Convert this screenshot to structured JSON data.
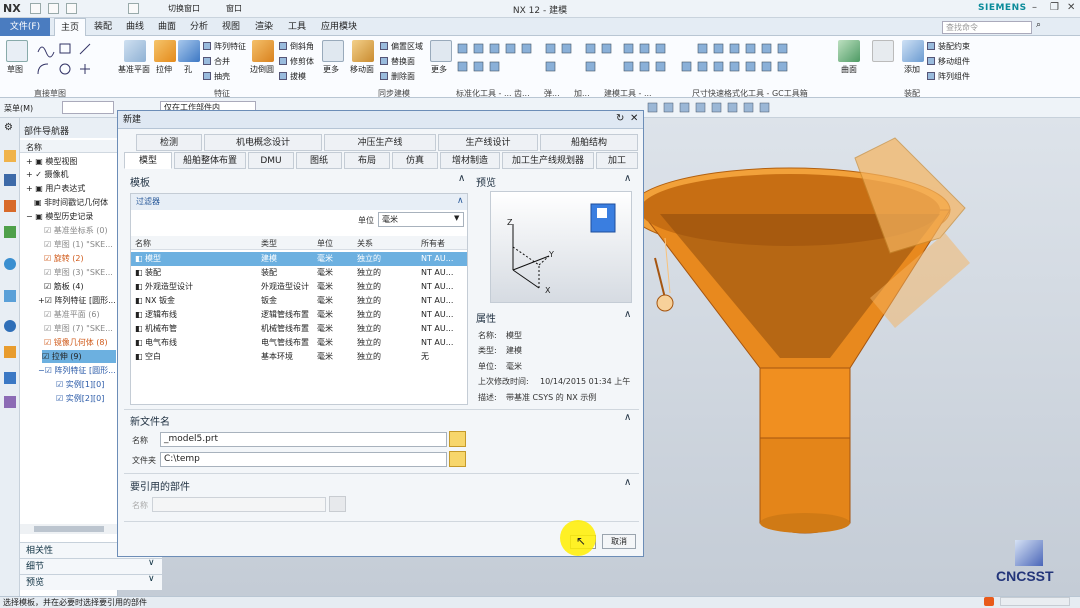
{
  "app": {
    "logo": "NX",
    "title": "NX 12 - 建模",
    "brand": "SIEMENS",
    "quick_switch_window": "切换窗口",
    "quick_window": "窗口"
  },
  "menu": {
    "file": "文件(F)",
    "tabs": [
      "主页",
      "装配",
      "曲线",
      "曲面",
      "分析",
      "视图",
      "渲染",
      "工具",
      "应用模块"
    ],
    "search_placeholder": "查找命令"
  },
  "ribbon": {
    "sketch": "草图",
    "datum_plane": "基准平面",
    "extrude": "拉伸",
    "hole": "孔",
    "pattern_feature": "阵列特征",
    "unite": "合并",
    "shell": "抽壳",
    "edge_blend": "边倒圆",
    "chamfer": "倒斜角",
    "trim_body": "修剪体",
    "draft": "拔模",
    "more1": "更多",
    "move_face": "移动面",
    "offset_region": "偏置区域",
    "replace_face": "替换面",
    "delete_face": "删除面",
    "more2": "更多",
    "surface": "曲面",
    "assembly_constraint": "装配约束",
    "add": "添加",
    "move_component": "移动组件",
    "pattern_component": "阵列组件",
    "sections": {
      "direct_sketch": "直接草图",
      "feature": "特征",
      "sync_modeling": "同步建模",
      "standard_tools": "标准化工具 - ...",
      "gear": "齿...",
      "spring": "弹...",
      "add": "加...",
      "modeling_tools": "建模工具 - ...",
      "dim_tools": "尺寸快速格式化工具 - GC工具箱",
      "assembly": "装配"
    }
  },
  "toolbar": {
    "menu": "菜单(M)",
    "filter": "仅在工作部件内"
  },
  "navigator": {
    "title": "部件导航器",
    "col_name": "名称",
    "items": [
      "模型视图",
      "摄像机",
      "用户表达式",
      "非时间戳记几何体",
      "模型历史记录",
      "基准坐标系 (0)",
      "草图 (1) \"SKE...",
      "旋转 (2)",
      "草图 (3) \"SKE...",
      "筋板 (4)",
      "阵列特征 [圆形...",
      "基准平面 (6)",
      "草图 (7) \"SKE...",
      "镜像几何体 (8)",
      "拉伸 (9)",
      "阵列特征 [圆形...",
      "实例[1][0]",
      "实例[2][0]"
    ],
    "panels": [
      "相关性",
      "细节",
      "预览"
    ]
  },
  "dialog": {
    "title": "新建",
    "tabs_row1": [
      "检测",
      "机电概念设计",
      "冲压生产线",
      "生产线设计",
      "船舶结构"
    ],
    "tabs_row2": [
      "模型",
      "船舶整体布置",
      "DMU",
      "图纸",
      "布局",
      "仿真",
      "增材制造",
      "加工生产线规划器",
      "加工"
    ],
    "template": {
      "title": "模板",
      "filter": "过滤器",
      "unit_label": "单位",
      "unit_value": "毫米",
      "columns": [
        "名称",
        "类型",
        "单位",
        "关系",
        "所有者"
      ],
      "rows": [
        [
          "模型",
          "建模",
          "毫米",
          "独立的",
          "NT AU..."
        ],
        [
          "装配",
          "装配",
          "毫米",
          "独立的",
          "NT AU..."
        ],
        [
          "外观造型设计",
          "外观造型设计",
          "毫米",
          "独立的",
          "NT AU..."
        ],
        [
          "NX 钣金",
          "钣金",
          "毫米",
          "独立的",
          "NT AU..."
        ],
        [
          "逻辑布线",
          "逻辑管线布置",
          "毫米",
          "独立的",
          "NT AU..."
        ],
        [
          "机械布管",
          "机械管线布置",
          "毫米",
          "独立的",
          "NT AU..."
        ],
        [
          "电气布线",
          "电气管线布置",
          "毫米",
          "独立的",
          "NT AU..."
        ],
        [
          "空白",
          "基本环境",
          "毫米",
          "独立的",
          "无"
        ]
      ]
    },
    "preview": {
      "title": "预览",
      "axis_x": "X",
      "axis_y": "Y",
      "axis_z": "Z"
    },
    "properties": {
      "title": "属性",
      "name_label": "名称:",
      "name_value": "模型",
      "type_label": "类型:",
      "type_value": "建模",
      "unit_label": "单位:",
      "unit_value": "毫米",
      "modified_label": "上次修改时间:",
      "modified_value": "10/14/2015 01:34 上午",
      "desc_label": "描述:",
      "desc_value": "带基准 CSYS 的 NX 示例"
    },
    "newfile": {
      "title": "新文件名",
      "name_label": "名称",
      "name_value": "_model5.prt",
      "folder_label": "文件夹",
      "folder_value": "C:\\temp"
    },
    "refpart": {
      "title": "要引用的部件",
      "name_label": "名称"
    },
    "cancel": "取消"
  },
  "status": "选择模板，并在必要时选择要引用的部件",
  "watermark": "CNCSST",
  "colors": {
    "accent": "#4a7cc0",
    "selection": "#6cb0e0",
    "part": "#e8891e"
  }
}
